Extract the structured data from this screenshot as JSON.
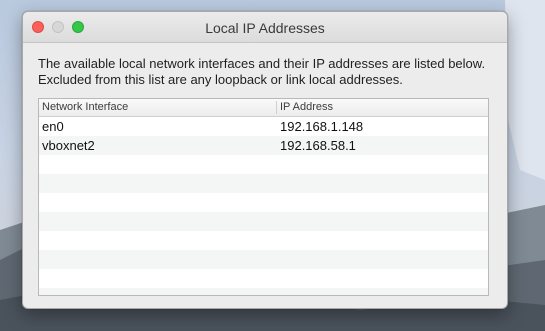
{
  "window": {
    "title": "Local IP Addresses"
  },
  "description": "The available local network interfaces and their IP addresses are listed below.  Excluded from this list are any loopback or link local addresses.",
  "table": {
    "columns": [
      "Network Interface",
      "IP Address"
    ],
    "rows": [
      [
        "en0",
        "192.168.1.148"
      ],
      [
        "vboxnet2",
        "192.168.58.1"
      ]
    ],
    "empty_rows": 8
  },
  "colors": {
    "close": "#fc605c",
    "minimize": "#d7d7d7",
    "zoom": "#34c84a"
  }
}
